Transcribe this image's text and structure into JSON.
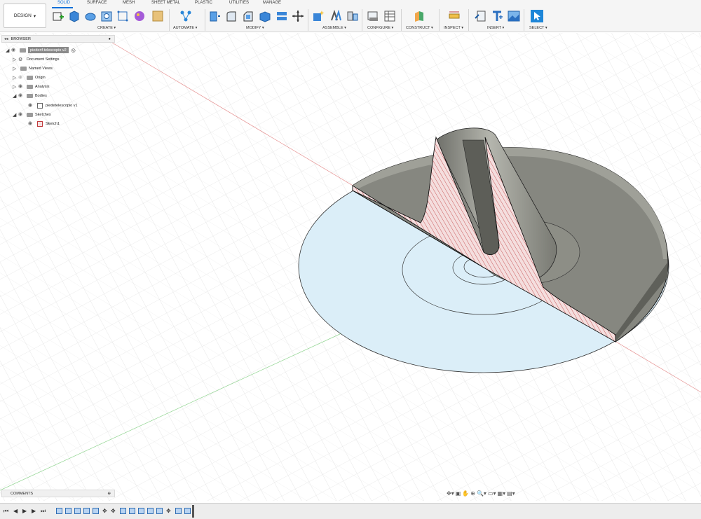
{
  "toolbar": {
    "workspace": "DESIGN",
    "tabs": [
      "SOLID",
      "SURFACE",
      "MESH",
      "SHEET METAL",
      "PLASTIC",
      "UTILITIES",
      "MANAGE"
    ],
    "active_tab": "SOLID",
    "groups": {
      "create": "CREATE ▾",
      "automate": "AUTOMATE ▾",
      "modify": "MODIFY ▾",
      "assemble": "ASSEMBLE ▾",
      "configure": "CONFIGURE ▾",
      "construct": "CONSTRUCT ▾",
      "inspect": "INSPECT ▾",
      "insert": "INSERT ▾",
      "select": "SELECT ▾"
    }
  },
  "browser": {
    "title": "BROWSER",
    "root": "piederif.telescopio v2",
    "items": {
      "document_settings": "Document Settings",
      "named_views": "Named Views",
      "origin": "Origin",
      "analysis": "Analysis",
      "bodies": "Bodies",
      "body1": "piedetelescopio v1",
      "sketches": "Sketches",
      "sketch1": "Sketch1"
    }
  },
  "comments": {
    "title": "COMMENTS"
  },
  "colors": {
    "accent": "#0b6fd8",
    "section_fill": "#f4dede",
    "section_hatch": "#c0393b",
    "body": "#8e8f87",
    "sketch_fill": "#dbeef8"
  }
}
